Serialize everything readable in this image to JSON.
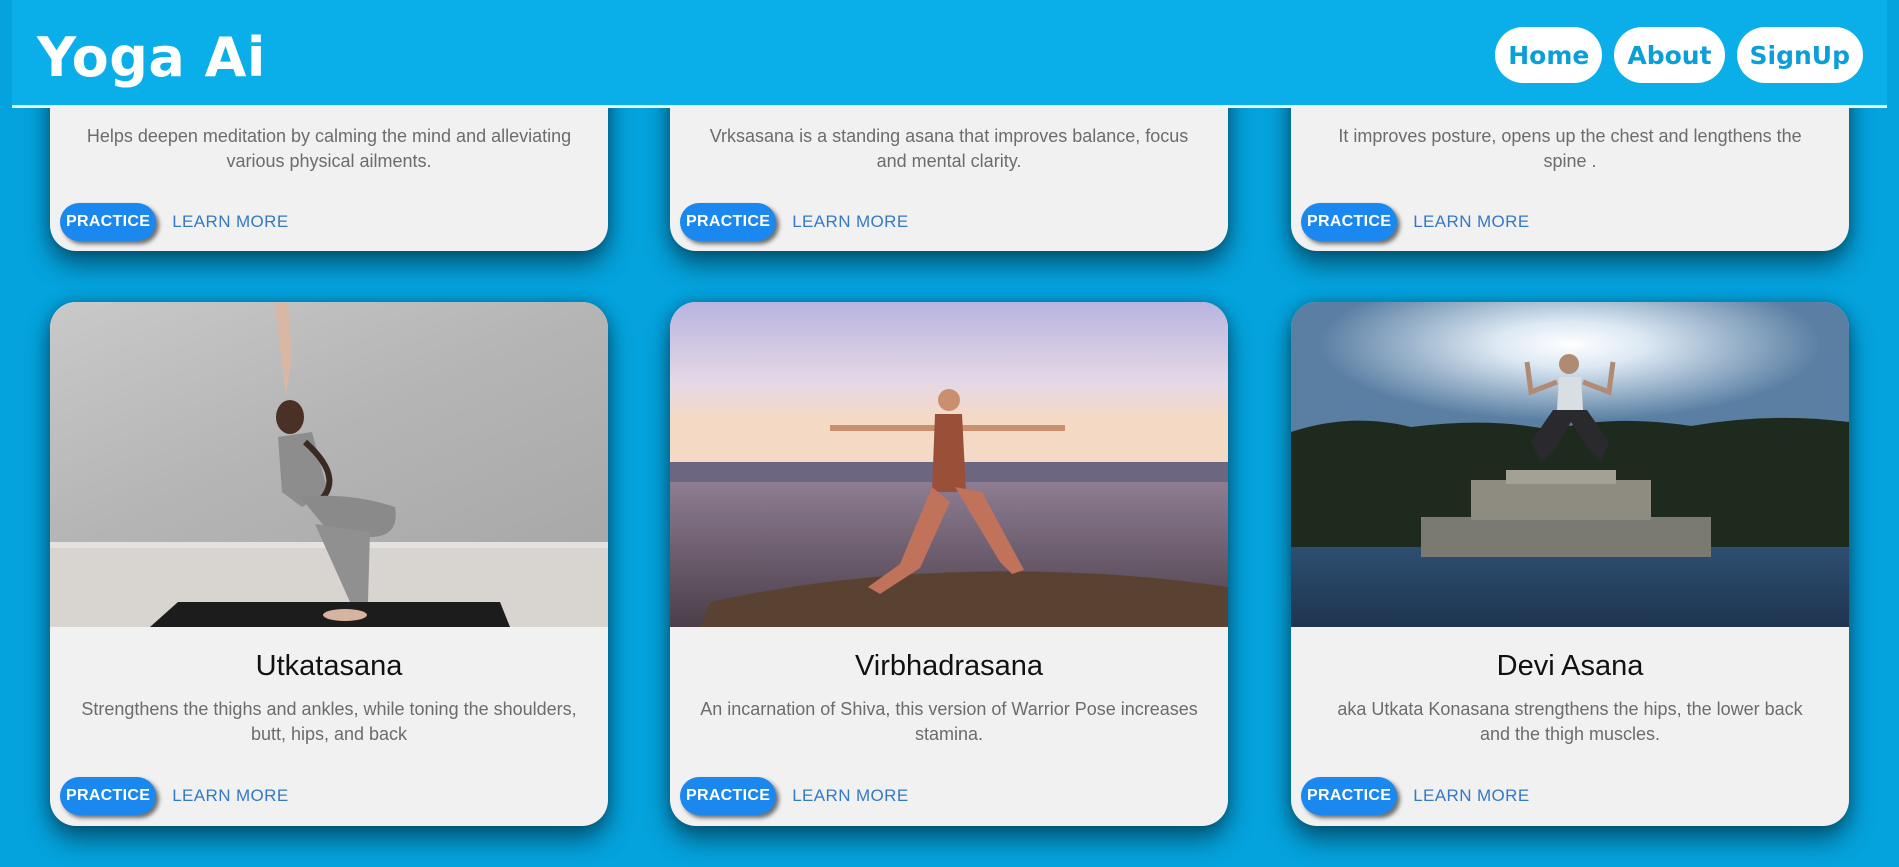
{
  "header": {
    "brand": "Yoga Ai",
    "nav": [
      "Home",
      "About",
      "SignUp"
    ]
  },
  "cards_top": [
    {
      "description": "Helps deepen meditation by calming the mind and alleviating various physical ailments.",
      "practice": "PRACTICE",
      "learn_more": "LEARN MORE"
    },
    {
      "description": "Vrksasana is a standing asana that improves balance, focus and mental clarity.",
      "practice": "PRACTICE",
      "learn_more": "LEARN MORE"
    },
    {
      "description": "It improves posture, opens up the chest and lengthens the spine .",
      "practice": "PRACTICE",
      "learn_more": "LEARN MORE"
    }
  ],
  "cards_bottom": [
    {
      "title": "Utkatasana",
      "description": "Strengthens the thighs and ankles, while toning the shoulders, butt, hips, and back",
      "practice": "PRACTICE",
      "learn_more": "LEARN MORE"
    },
    {
      "title": "Virbhadrasana",
      "description": "An incarnation of Shiva, this version of Warrior Pose increases stamina.",
      "practice": "PRACTICE",
      "learn_more": "LEARN MORE"
    },
    {
      "title": "Devi Asana",
      "description": "aka Utkata Konasana strengthens the hips, the lower back and the thigh muscles.",
      "practice": "PRACTICE",
      "learn_more": "LEARN MORE"
    }
  ],
  "colors": {
    "background": "#04a3de",
    "navbar": "#0aaee8",
    "practice_button": "#1b88f0",
    "link": "#3479c6"
  }
}
